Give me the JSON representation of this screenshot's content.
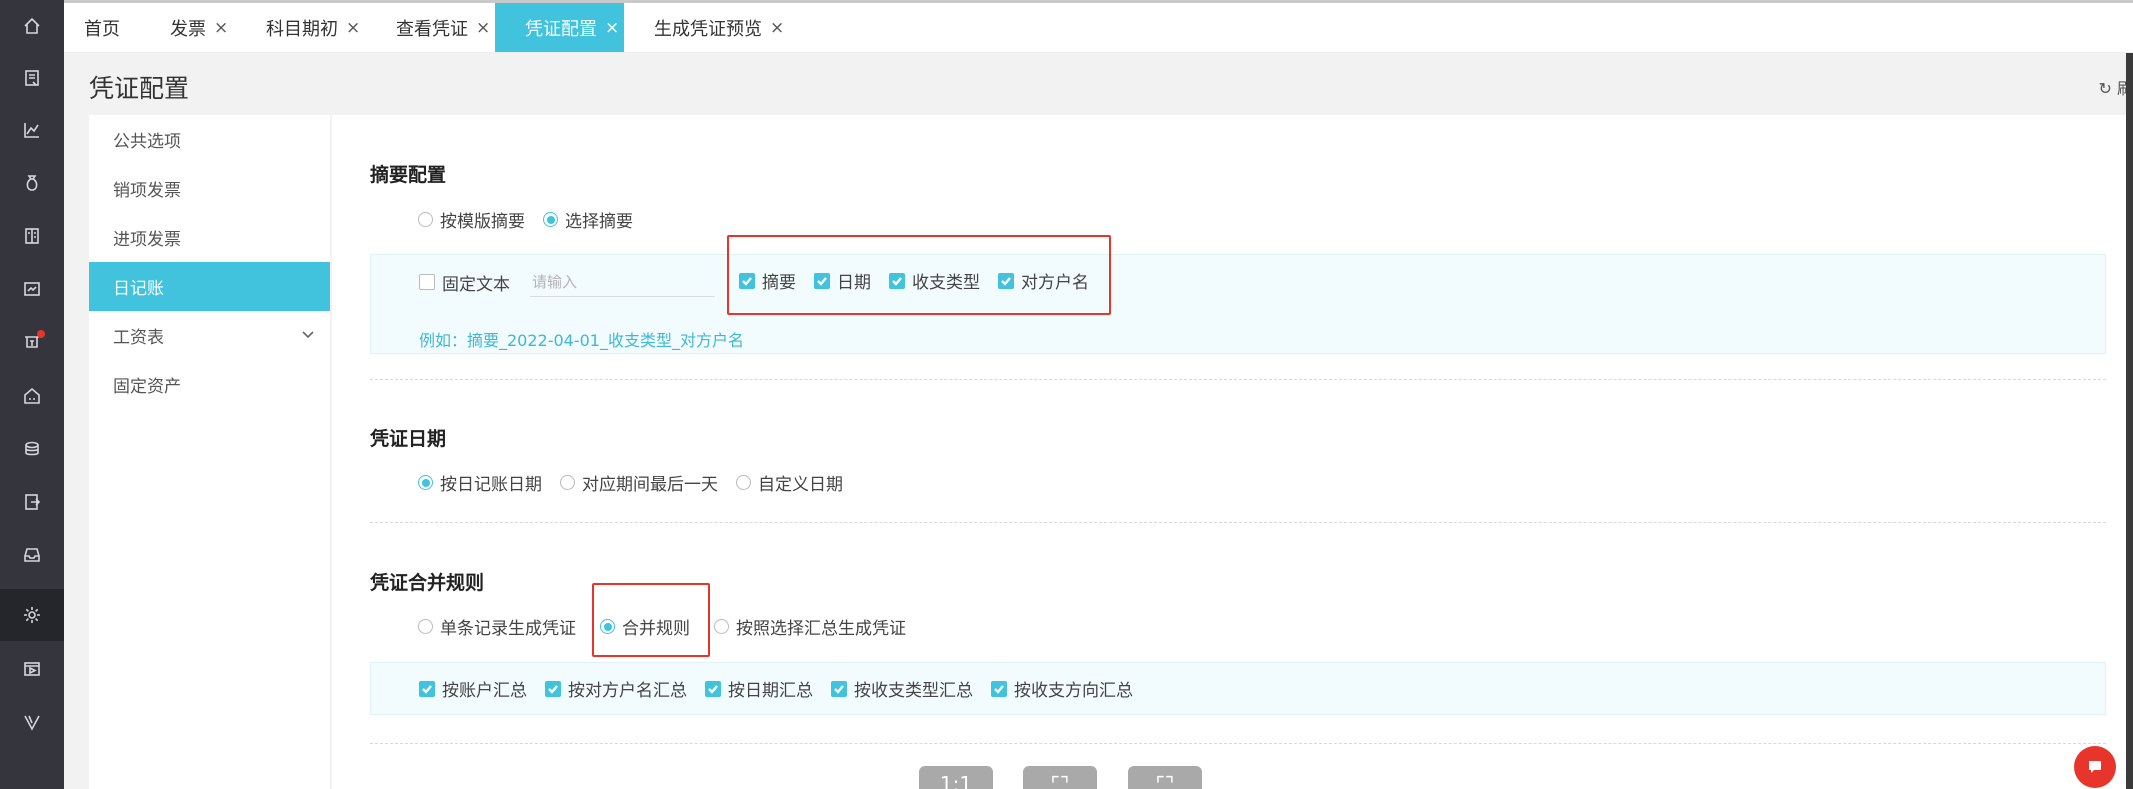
{
  "tabs": [
    {
      "label": "首页",
      "closable": false
    },
    {
      "label": "发票",
      "closable": true
    },
    {
      "label": "科目期初",
      "closable": true
    },
    {
      "label": "查看凭证",
      "closable": true
    },
    {
      "label": "凭证配置",
      "closable": true,
      "active": true
    },
    {
      "label": "生成凭证预览",
      "closable": true
    }
  ],
  "close_glyph": "×",
  "page_title": "凭证配置",
  "refresh_label": "刷",
  "submenu": [
    {
      "label": "公共选项"
    },
    {
      "label": "销项发票"
    },
    {
      "label": "进项发票"
    },
    {
      "label": "日记账",
      "active": true
    },
    {
      "label": "工资表",
      "expandable": true
    },
    {
      "label": "固定资产"
    }
  ],
  "summary": {
    "title": "摘要配置",
    "modes": [
      {
        "label": "按模版摘要",
        "checked": false
      },
      {
        "label": "选择摘要",
        "checked": true
      }
    ],
    "fixed_text": {
      "label": "固定文本",
      "checked": false,
      "placeholder": "请输入"
    },
    "fields": [
      {
        "label": "摘要",
        "checked": true
      },
      {
        "label": "日期",
        "checked": true
      },
      {
        "label": "收支类型",
        "checked": true
      },
      {
        "label": "对方户名",
        "checked": true
      }
    ],
    "example": "例如：摘要_2022-04-01_收支类型_对方户名"
  },
  "voucher_date": {
    "title": "凭证日期",
    "options": [
      {
        "label": "按日记账日期",
        "checked": true
      },
      {
        "label": "对应期间最后一天",
        "checked": false
      },
      {
        "label": "自定义日期",
        "checked": false
      }
    ]
  },
  "merge_rule": {
    "title": "凭证合并规则",
    "options": [
      {
        "label": "单条记录生成凭证",
        "checked": false
      },
      {
        "label": "合并规则",
        "checked": true
      },
      {
        "label": "按照选择汇总生成凭证",
        "checked": false
      }
    ],
    "criteria": [
      {
        "label": "按账户汇总",
        "checked": true
      },
      {
        "label": "按对方户名汇总",
        "checked": true
      },
      {
        "label": "按日期汇总",
        "checked": true
      },
      {
        "label": "按收支类型汇总",
        "checked": true
      },
      {
        "label": "按收支方向汇总",
        "checked": true
      }
    ]
  },
  "viewer_buttons": [
    {
      "label": "1:1"
    },
    {
      "label": "⌜⌝"
    },
    {
      "label": "⌜⌝"
    }
  ],
  "colors": {
    "accent": "#41c3dd",
    "rail": "#34353d",
    "highlight_box": "#e8352b"
  }
}
